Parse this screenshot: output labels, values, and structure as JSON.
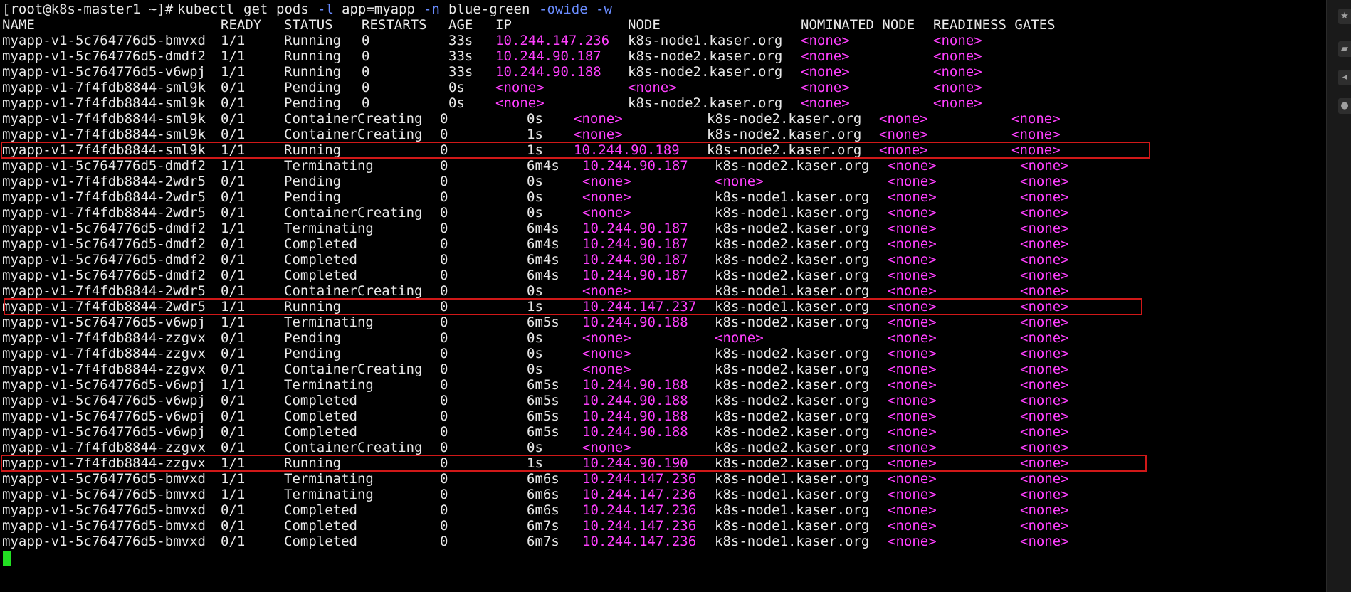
{
  "prompt": {
    "user_host": "[root@k8s-master1 ~]# ",
    "cmd_words": [
      "kubectl",
      "get",
      "pods"
    ],
    "flag_l": "-l",
    "label_selector": "app=myapp",
    "flag_n": "-n",
    "namespace": "blue-green",
    "flag_o": "-owide",
    "flag_w": "-w"
  },
  "header": {
    "name": "NAME",
    "ready": "READY",
    "status": "STATUS",
    "restarts": "RESTARTS",
    "age": "AGE",
    "ip": "IP",
    "node": "NODE",
    "nominated": "NOMINATED NODE",
    "gates": "READINESS GATES"
  },
  "rows": [
    {
      "name": "myapp-v1-5c764776d5-bmvxd",
      "ready": "1/1",
      "status": "Running",
      "restarts": "0",
      "age": "33s",
      "ip": "10.244.147.236",
      "node": "k8s-node1.kaser.org",
      "nominated": "<none>",
      "gates": "<none>"
    },
    {
      "name": "myapp-v1-5c764776d5-dmdf2",
      "ready": "1/1",
      "status": "Running",
      "restarts": "0",
      "age": "33s",
      "ip": "10.244.90.187",
      "node": "k8s-node2.kaser.org",
      "nominated": "<none>",
      "gates": "<none>"
    },
    {
      "name": "myapp-v1-5c764776d5-v6wpj",
      "ready": "1/1",
      "status": "Running",
      "restarts": "0",
      "age": "33s",
      "ip": "10.244.90.188",
      "node": "k8s-node2.kaser.org",
      "nominated": "<none>",
      "gates": "<none>"
    },
    {
      "name": "myapp-v1-7f4fdb8844-sml9k",
      "ready": "0/1",
      "status": "Pending",
      "restarts": "0",
      "age": "0s",
      "ip": "<none>",
      "node": "<none>",
      "nominated": "<none>",
      "gates": "<none>"
    },
    {
      "name": "myapp-v1-7f4fdb8844-sml9k",
      "ready": "0/1",
      "status": "Pending",
      "restarts": "0",
      "age": "0s",
      "ip": "<none>",
      "node": "k8s-node2.kaser.org",
      "nominated": "<none>",
      "gates": "<none>"
    },
    {
      "name": "myapp-v1-7f4fdb8844-sml9k",
      "ready": "0/1",
      "status": "ContainerCreating",
      "restarts": "0",
      "age": "0s",
      "ip": "<none>",
      "node": "k8s-node2.kaser.org",
      "nominated": "<none>",
      "gates": "<none>"
    },
    {
      "name": "myapp-v1-7f4fdb8844-sml9k",
      "ready": "0/1",
      "status": "ContainerCreating",
      "restarts": "0",
      "age": "1s",
      "ip": "<none>",
      "node": "k8s-node2.kaser.org",
      "nominated": "<none>",
      "gates": "<none>"
    },
    {
      "name": "myapp-v1-7f4fdb8844-sml9k",
      "ready": "1/1",
      "status": "Running",
      "restarts": "0",
      "age": "1s",
      "ip": "10.244.90.189",
      "node": "k8s-node2.kaser.org",
      "nominated": "<none>",
      "gates": "<none>"
    },
    {
      "name": "myapp-v1-5c764776d5-dmdf2",
      "ready": "1/1",
      "status": "Terminating",
      "restarts": "0",
      "age": "6m4s",
      "ip": "10.244.90.187",
      "node": "k8s-node2.kaser.org",
      "nominated": "<none>",
      "gates": "<none>"
    },
    {
      "name": "myapp-v1-7f4fdb8844-2wdr5",
      "ready": "0/1",
      "status": "Pending",
      "restarts": "0",
      "age": "0s",
      "ip": "<none>",
      "node": "<none>",
      "nominated": "<none>",
      "gates": "<none>"
    },
    {
      "name": "myapp-v1-7f4fdb8844-2wdr5",
      "ready": "0/1",
      "status": "Pending",
      "restarts": "0",
      "age": "0s",
      "ip": "<none>",
      "node": "k8s-node1.kaser.org",
      "nominated": "<none>",
      "gates": "<none>"
    },
    {
      "name": "myapp-v1-7f4fdb8844-2wdr5",
      "ready": "0/1",
      "status": "ContainerCreating",
      "restarts": "0",
      "age": "0s",
      "ip": "<none>",
      "node": "k8s-node1.kaser.org",
      "nominated": "<none>",
      "gates": "<none>"
    },
    {
      "name": "myapp-v1-5c764776d5-dmdf2",
      "ready": "1/1",
      "status": "Terminating",
      "restarts": "0",
      "age": "6m4s",
      "ip": "10.244.90.187",
      "node": "k8s-node2.kaser.org",
      "nominated": "<none>",
      "gates": "<none>"
    },
    {
      "name": "myapp-v1-5c764776d5-dmdf2",
      "ready": "0/1",
      "status": "Completed",
      "restarts": "0",
      "age": "6m4s",
      "ip": "10.244.90.187",
      "node": "k8s-node2.kaser.org",
      "nominated": "<none>",
      "gates": "<none>"
    },
    {
      "name": "myapp-v1-5c764776d5-dmdf2",
      "ready": "0/1",
      "status": "Completed",
      "restarts": "0",
      "age": "6m4s",
      "ip": "10.244.90.187",
      "node": "k8s-node2.kaser.org",
      "nominated": "<none>",
      "gates": "<none>"
    },
    {
      "name": "myapp-v1-5c764776d5-dmdf2",
      "ready": "0/1",
      "status": "Completed",
      "restarts": "0",
      "age": "6m4s",
      "ip": "10.244.90.187",
      "node": "k8s-node2.kaser.org",
      "nominated": "<none>",
      "gates": "<none>"
    },
    {
      "name": "myapp-v1-7f4fdb8844-2wdr5",
      "ready": "0/1",
      "status": "ContainerCreating",
      "restarts": "0",
      "age": "0s",
      "ip": "<none>",
      "node": "k8s-node1.kaser.org",
      "nominated": "<none>",
      "gates": "<none>"
    },
    {
      "name": "myapp-v1-7f4fdb8844-2wdr5",
      "ready": "1/1",
      "status": "Running",
      "restarts": "0",
      "age": "1s",
      "ip": "10.244.147.237",
      "node": "k8s-node1.kaser.org",
      "nominated": "<none>",
      "gates": "<none>"
    },
    {
      "name": "myapp-v1-5c764776d5-v6wpj",
      "ready": "1/1",
      "status": "Terminating",
      "restarts": "0",
      "age": "6m5s",
      "ip": "10.244.90.188",
      "node": "k8s-node2.kaser.org",
      "nominated": "<none>",
      "gates": "<none>"
    },
    {
      "name": "myapp-v1-7f4fdb8844-zzgvx",
      "ready": "0/1",
      "status": "Pending",
      "restarts": "0",
      "age": "0s",
      "ip": "<none>",
      "node": "<none>",
      "nominated": "<none>",
      "gates": "<none>"
    },
    {
      "name": "myapp-v1-7f4fdb8844-zzgvx",
      "ready": "0/1",
      "status": "Pending",
      "restarts": "0",
      "age": "0s",
      "ip": "<none>",
      "node": "k8s-node2.kaser.org",
      "nominated": "<none>",
      "gates": "<none>"
    },
    {
      "name": "myapp-v1-7f4fdb8844-zzgvx",
      "ready": "0/1",
      "status": "ContainerCreating",
      "restarts": "0",
      "age": "0s",
      "ip": "<none>",
      "node": "k8s-node2.kaser.org",
      "nominated": "<none>",
      "gates": "<none>"
    },
    {
      "name": "myapp-v1-5c764776d5-v6wpj",
      "ready": "1/1",
      "status": "Terminating",
      "restarts": "0",
      "age": "6m5s",
      "ip": "10.244.90.188",
      "node": "k8s-node2.kaser.org",
      "nominated": "<none>",
      "gates": "<none>"
    },
    {
      "name": "myapp-v1-5c764776d5-v6wpj",
      "ready": "0/1",
      "status": "Completed",
      "restarts": "0",
      "age": "6m5s",
      "ip": "10.244.90.188",
      "node": "k8s-node2.kaser.org",
      "nominated": "<none>",
      "gates": "<none>"
    },
    {
      "name": "myapp-v1-5c764776d5-v6wpj",
      "ready": "0/1",
      "status": "Completed",
      "restarts": "0",
      "age": "6m5s",
      "ip": "10.244.90.188",
      "node": "k8s-node2.kaser.org",
      "nominated": "<none>",
      "gates": "<none>"
    },
    {
      "name": "myapp-v1-5c764776d5-v6wpj",
      "ready": "0/1",
      "status": "Completed",
      "restarts": "0",
      "age": "6m5s",
      "ip": "10.244.90.188",
      "node": "k8s-node2.kaser.org",
      "nominated": "<none>",
      "gates": "<none>"
    },
    {
      "name": "myapp-v1-7f4fdb8844-zzgvx",
      "ready": "0/1",
      "status": "ContainerCreating",
      "restarts": "0",
      "age": "0s",
      "ip": "<none>",
      "node": "k8s-node2.kaser.org",
      "nominated": "<none>",
      "gates": "<none>"
    },
    {
      "name": "myapp-v1-7f4fdb8844-zzgvx",
      "ready": "1/1",
      "status": "Running",
      "restarts": "0",
      "age": "1s",
      "ip": "10.244.90.190",
      "node": "k8s-node2.kaser.org",
      "nominated": "<none>",
      "gates": "<none>"
    },
    {
      "name": "myapp-v1-5c764776d5-bmvxd",
      "ready": "1/1",
      "status": "Terminating",
      "restarts": "0",
      "age": "6m6s",
      "ip": "10.244.147.236",
      "node": "k8s-node1.kaser.org",
      "nominated": "<none>",
      "gates": "<none>"
    },
    {
      "name": "myapp-v1-5c764776d5-bmvxd",
      "ready": "1/1",
      "status": "Terminating",
      "restarts": "0",
      "age": "6m6s",
      "ip": "10.244.147.236",
      "node": "k8s-node1.kaser.org",
      "nominated": "<none>",
      "gates": "<none>"
    },
    {
      "name": "myapp-v1-5c764776d5-bmvxd",
      "ready": "0/1",
      "status": "Completed",
      "restarts": "0",
      "age": "6m6s",
      "ip": "10.244.147.236",
      "node": "k8s-node1.kaser.org",
      "nominated": "<none>",
      "gates": "<none>"
    },
    {
      "name": "myapp-v1-5c764776d5-bmvxd",
      "ready": "0/1",
      "status": "Completed",
      "restarts": "0",
      "age": "6m7s",
      "ip": "10.244.147.236",
      "node": "k8s-node1.kaser.org",
      "nominated": "<none>",
      "gates": "<none>"
    },
    {
      "name": "myapp-v1-5c764776d5-bmvxd",
      "ready": "0/1",
      "status": "Completed",
      "restarts": "0",
      "age": "6m7s",
      "ip": "10.244.147.236",
      "node": "k8s-node1.kaser.org",
      "nominated": "<none>",
      "gates": "<none>"
    }
  ],
  "highlighted_rows": [
    7,
    17,
    27
  ],
  "sidebar_icons": [
    "star-icon",
    "tag-icon",
    "arrow-icon",
    "circle-icon"
  ],
  "colors": {
    "background": "#000000",
    "text": "#e8e8e8",
    "magenta": "#ff40ff",
    "flag_blue": "#6a8cff",
    "highlight_red": "#d01818",
    "cursor_green": "#22e022"
  }
}
